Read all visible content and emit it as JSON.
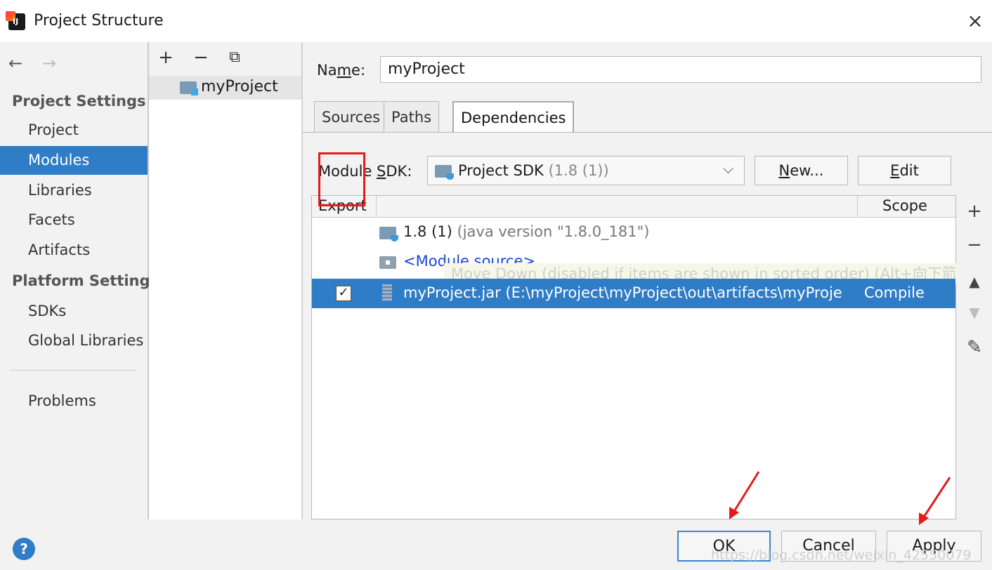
{
  "window": {
    "title": "Project Structure",
    "close": "×"
  },
  "nav": {
    "back": "←",
    "forward": "→",
    "project_settings": "Project Settings",
    "platform_settings": "Platform Settings",
    "items": [
      "Project",
      "Modules",
      "Libraries",
      "Facets",
      "Artifacts"
    ],
    "platform_items": [
      "SDKs",
      "Global Libraries"
    ],
    "problems": "Problems",
    "selected": "Modules"
  },
  "modules": {
    "toolbar": {
      "add": "+",
      "remove": "−",
      "copy": "⧉"
    },
    "list": [
      "myProject"
    ]
  },
  "module": {
    "name_label_pre": "Na",
    "name_label_u": "m",
    "name_label_post": "e:",
    "name_value": "myProject",
    "tabs": [
      "Sources",
      "Paths",
      "Dependencies"
    ],
    "active_tab": "Dependencies",
    "sdk_label_pre": "Module ",
    "sdk_label_u": "S",
    "sdk_label_post": "DK:",
    "sdk_value": "Project SDK",
    "sdk_sub": "(1.8 (1))",
    "sdk_chevron": "⌵",
    "new_u": "N",
    "new_rest": "ew...",
    "edit_u": "E",
    "edit_rest": "dit"
  },
  "dependencies": {
    "header_export": "Export",
    "header_scope": "Scope",
    "rows": [
      {
        "main": "1.8 (1)",
        "sub": " (java version \"1.8.0_181\")"
      },
      {
        "main": "<Module source>"
      },
      {
        "main": "myProject.jar (E:\\myProject\\myProject\\out\\artifacts\\myProje",
        "scope": "Compile",
        "checked": "✓"
      }
    ],
    "tooltip": "Move Down (disabled if items are shown in sorted order) (Alt+向下箭头)"
  },
  "side_toolbar": {
    "add": "+",
    "remove": "−",
    "up": "▲",
    "down": "▼",
    "edit": "✎"
  },
  "bottom": {
    "help": "?",
    "ok": "OK",
    "cancel": "Cancel",
    "apply": "Apply",
    "watermark": "https://blog.csdn.net/weixin_42550079"
  },
  "colors": {
    "accent": "#2f7cc7",
    "annotation": "#e41b1b"
  }
}
